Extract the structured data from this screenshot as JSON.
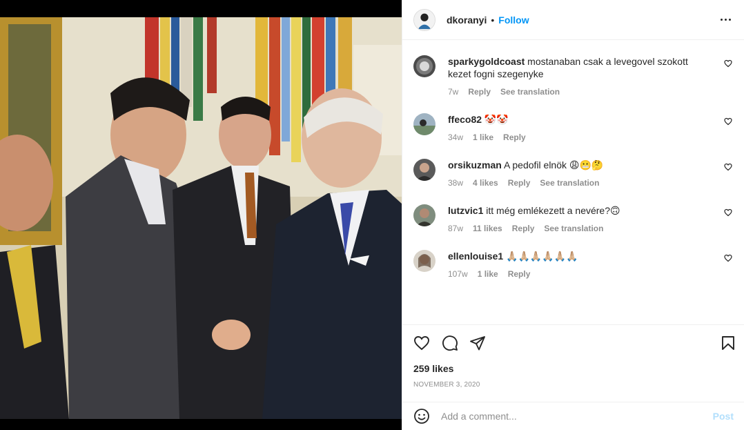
{
  "post": {
    "owner": "dkoranyi",
    "separator": "•",
    "follow_label": "Follow",
    "likes": "259 likes",
    "date": "NOVEMBER 3, 2020"
  },
  "comments": [
    {
      "user": "sparkygoldcoast",
      "text": "mostanaban csak a levegovel szokott kezet fogni szegenyke",
      "time": "7w",
      "likes": "",
      "reply": "Reply",
      "translate": "See translation"
    },
    {
      "user": "ffeco82",
      "text": "🤡🤡",
      "time": "34w",
      "likes": "1 like",
      "reply": "Reply",
      "translate": ""
    },
    {
      "user": "orsikuzman",
      "text": "A pedofil elnök 😩😬🤔",
      "time": "38w",
      "likes": "4 likes",
      "reply": "Reply",
      "translate": "See translation"
    },
    {
      "user": "lutzvic1",
      "text": "itt még emlékezett a nevére?🙃",
      "time": "87w",
      "likes": "11 likes",
      "reply": "Reply",
      "translate": "See translation"
    },
    {
      "user": "ellenlouise1",
      "text": "🙏🏼🙏🏼🙏🏼🙏🏼🙏🏼🙏🏼",
      "time": "107w",
      "likes": "1 like",
      "reply": "Reply",
      "translate": ""
    }
  ],
  "add_comment": {
    "placeholder": "Add a comment...",
    "post_label": "Post"
  },
  "icons": {
    "more": "more-options-icon",
    "like": "heart-icon",
    "comment": "comment-bubble-icon",
    "share": "paper-plane-icon",
    "save": "bookmark-icon",
    "emoji": "emoji-smiley-icon"
  },
  "colors": {
    "link": "#0095f6",
    "post_disabled": "#b2dffc",
    "secondary_text": "#8e8e8e",
    "primary_text": "#262626"
  }
}
